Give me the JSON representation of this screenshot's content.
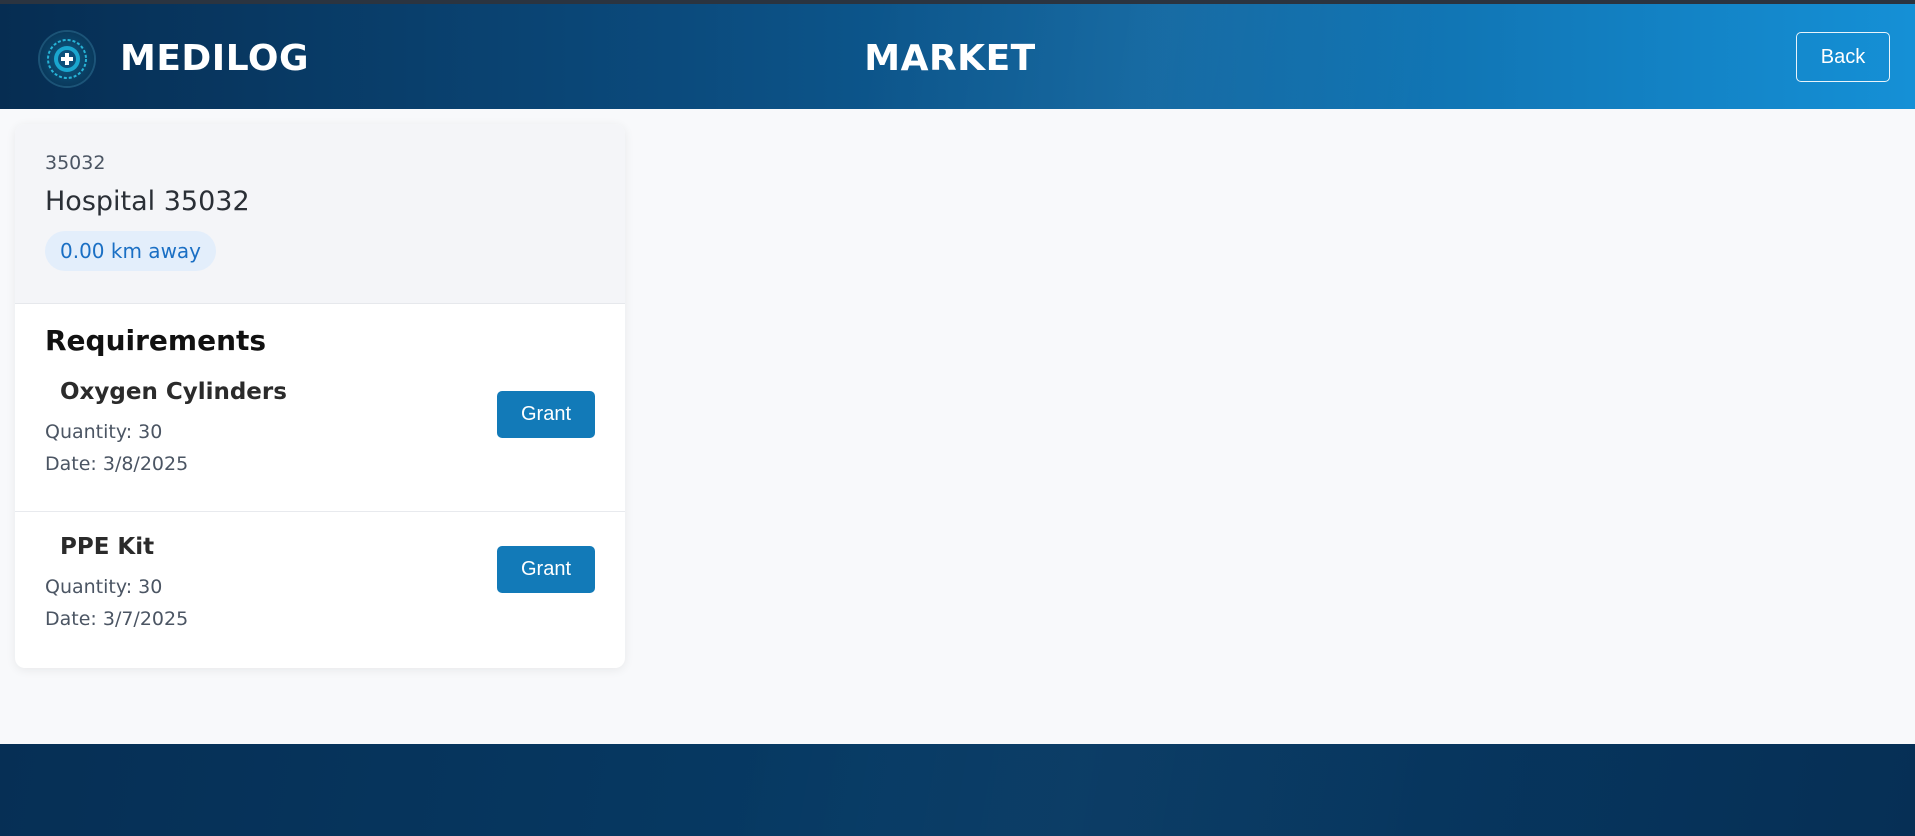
{
  "header": {
    "brand": "MEDILOG",
    "title": "MARKET",
    "back_label": "Back",
    "logo_icon": "medical-cross-logo-icon"
  },
  "hospital": {
    "id": "35032",
    "name": "Hospital 35032",
    "distance": "0.00 km away"
  },
  "requirements": {
    "heading": "Requirements",
    "items": [
      {
        "name": "Oxygen Cylinders",
        "quantity": "Quantity: 30",
        "date": "Date: 3/8/2025",
        "action": "Grant"
      },
      {
        "name": "PPE Kit",
        "quantity": "Quantity: 30",
        "date": "Date: 3/7/2025",
        "action": "Grant"
      }
    ]
  },
  "colors": {
    "header_start": "#062d52",
    "header_end": "#1590d6",
    "grant_button": "#127ab8",
    "distance_badge_bg": "#e3eefb",
    "distance_badge_text": "#1a6fc4",
    "footer": "#063a64"
  }
}
